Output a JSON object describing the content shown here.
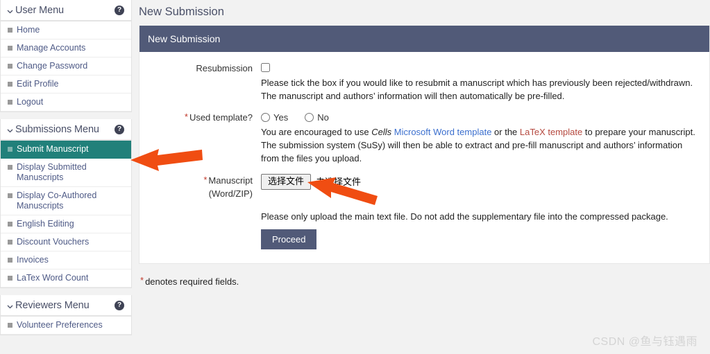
{
  "sidebar": {
    "panels": [
      {
        "title": "User Menu",
        "help_icon": "question-mark-circle-icon",
        "chevron": "chevron-down-icon",
        "items": [
          {
            "label": "Home",
            "active": false
          },
          {
            "label": "Manage Accounts",
            "active": false
          },
          {
            "label": "Change Password",
            "active": false
          },
          {
            "label": "Edit Profile",
            "active": false
          },
          {
            "label": "Logout",
            "active": false
          }
        ]
      },
      {
        "title": "Submissions Menu",
        "help_icon": "question-mark-circle-icon",
        "chevron": "chevron-down-icon",
        "items": [
          {
            "label": "Submit Manuscript",
            "active": true
          },
          {
            "label": "Display Submitted Manuscripts",
            "active": false
          },
          {
            "label": "Display Co-Authored Manuscripts",
            "active": false
          },
          {
            "label": "English Editing",
            "active": false
          },
          {
            "label": "Discount Vouchers",
            "active": false
          },
          {
            "label": "Invoices",
            "active": false
          },
          {
            "label": "LaTex Word Count",
            "active": false
          }
        ]
      },
      {
        "title": "Reviewers Menu",
        "help_icon": "question-mark-circle-icon",
        "chevron": "chevron-down-icon",
        "items": [
          {
            "label": "Volunteer Preferences",
            "active": false
          }
        ]
      }
    ]
  },
  "main": {
    "page_title": "New Submission",
    "card_header": "New Submission",
    "resubmission": {
      "label": "Resubmission",
      "checked": false,
      "help_text": "Please tick the box if you would like to resubmit a manuscript which has previously been rejected/withdrawn. The manuscript and authors’ information will then automatically be pre-filled."
    },
    "used_template": {
      "label": "Used template?",
      "required": true,
      "required_marker": "*",
      "options": [
        {
          "label": "Yes",
          "selected": false
        },
        {
          "label": "No",
          "selected": false
        }
      ],
      "help_text_1": "You are encouraged to use ",
      "journal_name": "Cells",
      "link_word": " Microsoft Word template",
      "help_text_2": " or the ",
      "link_latex": "LaTeX template",
      "help_text_3": " to prepare your manuscript. The submission system (SuSy) will then be able to extract and pre-fill manuscript and authors’ information from the files you upload."
    },
    "manuscript": {
      "label_line1": "Manuscript",
      "label_line2": "(Word/ZIP)",
      "required": true,
      "required_marker": "*",
      "file_button": "选择文件",
      "file_status": "未选择文件",
      "help_text": "Please only upload the main text file. Do not add the supplementary file into the compressed package."
    },
    "proceed_button": "Proceed",
    "required_note_marker": "*",
    "required_note": "denotes required fields."
  },
  "watermark": {
    "text": "CSDN @鱼与钰遇雨"
  },
  "colors": {
    "header_bar": "#515a78",
    "active_item": "#21807a",
    "link_blue": "#3b6fce",
    "link_red": "#b5493f",
    "required_star": "#c0392b",
    "arrow_orange": "#f04d12",
    "page_background": "#f2f2f2"
  }
}
